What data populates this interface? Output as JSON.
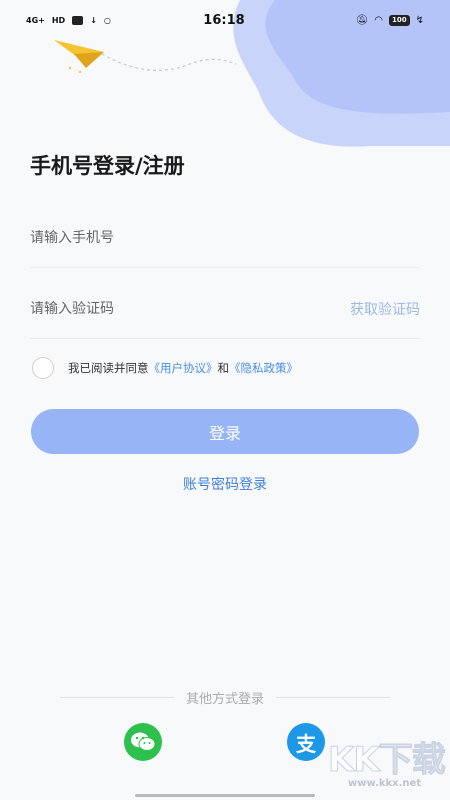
{
  "status_bar": {
    "signal": "4G+",
    "hd": "HD",
    "time": "16:18",
    "battery": "100"
  },
  "login": {
    "title": "手机号登录/注册",
    "phone_placeholder": "请输入手机号",
    "code_placeholder": "请输入验证码",
    "get_code": "获取验证码",
    "agree_prefix": "我已阅读并同意",
    "user_agreement": "《用户协议》",
    "and": "和",
    "privacy_policy": "《隐私政策》",
    "login_button": "登录",
    "password_login": "账号密码登录"
  },
  "other_login": {
    "label": "其他方式登录",
    "alipay_glyph": "支"
  },
  "watermark": {
    "text": "KK下载",
    "url": "www.kkx.net"
  },
  "colors": {
    "accent": "#97b4f7",
    "link": "#4a8de6",
    "wechat": "#2ec04c",
    "alipay": "#1d98e6"
  }
}
